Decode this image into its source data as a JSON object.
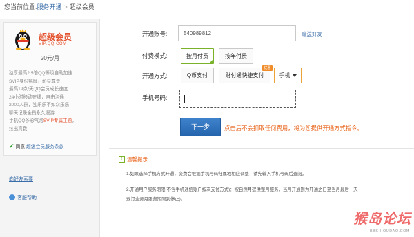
{
  "breadcrumb": {
    "prefix": "您当前位置:",
    "link": "服务开通",
    "separator": ">",
    "current": "超级会员"
  },
  "sidebar": {
    "vip_title": "超级会员",
    "vip_url": "VIP.QQ.COM",
    "price": "20元/月",
    "features": [
      "独享最高2.5倍QQ等级自助加速",
      "SVIP身份铭牌，彰显尊贵",
      "最高19点/天QQ会员成长速度",
      "24小时移动在线，自由沟通",
      "2000人群，独乐乐不如众乐乐",
      "聊天记录全员永久漫游"
    ],
    "feature_theme_prefix": "手机QQ多彩气泡",
    "feature_theme_highlight": "SVIP专属主题",
    "feature_theme_suffix": "，",
    "feature_last": "炫出真我",
    "agree_prefix": "同意",
    "agree_link": "超级会员服务条款",
    "gift_link": "向好友索要",
    "help_link": "客服帮助"
  },
  "form": {
    "account_label": "开通账号:",
    "account_value": "540989812",
    "gift_friend": "赠送好友",
    "mode_label": "付费模式:",
    "mode_options": [
      "按月付费",
      "按年付费"
    ],
    "method_label": "开通方式:",
    "method_options": [
      "Q币支付",
      "财付通快捷支付",
      "手机"
    ],
    "method_badge": "优惠",
    "phone_label": "手机号码:",
    "phone_value": "",
    "next_button": "下一步",
    "next_hint": "点击后不会扣取任何费用，将为您提供开通方式指令。"
  },
  "tips": {
    "icon": "!",
    "title": "温馨提示",
    "line1": "1.如果选择手机方式开通，资费会根据手机号码归属地相应调整，请先输入手机号码后查阅。",
    "line2": "2.开通用户服务期限(不含手机通信账户按次支付方式)：按自然月提供整月服务，当月开通则为开通之日至当月最后一天",
    "line3": "退订业务月服务期限到停止)。"
  },
  "watermark": {
    "text": "猴岛论坛",
    "url": "BBS.HOUDAO.COM"
  },
  "colors": {
    "link_blue": "#3b6ea8",
    "accent_orange": "#e8641b",
    "brand_red": "#e4532f",
    "selected_green": "#7ab32a",
    "button_blue": "#2d6fb8"
  }
}
